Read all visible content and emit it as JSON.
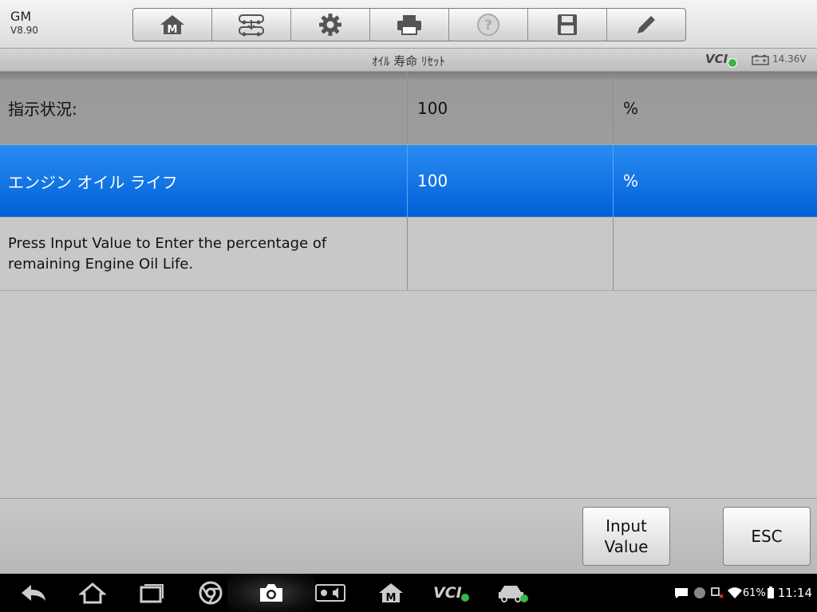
{
  "header": {
    "brand": "GM",
    "version": "V8.90",
    "toolbar": [
      {
        "icon": "home-icon"
      },
      {
        "icon": "vehicle-swap-icon"
      },
      {
        "icon": "gear-icon"
      },
      {
        "icon": "printer-icon"
      },
      {
        "icon": "help-icon"
      },
      {
        "icon": "save-icon"
      },
      {
        "icon": "pencil-icon"
      }
    ]
  },
  "titlebar": {
    "title": "ｵｲﾙ 寿命 ﾘｾｯﾄ",
    "vci": "VCI",
    "voltage": "14.36V"
  },
  "table": {
    "rows": [
      {
        "label": "指示状況:",
        "value": "100",
        "unit": "%"
      },
      {
        "label": "エンジン オイル ライフ",
        "value": "100",
        "unit": "%"
      },
      {
        "label": "Press Input Value to Enter the percentage of remaining Engine Oil Life.",
        "value": "",
        "unit": ""
      }
    ]
  },
  "actions": {
    "input_value": "Input Value",
    "esc": "ESC"
  },
  "status": {
    "battery": "61%",
    "time": "11:14"
  },
  "colors": {
    "selected_row": "#1f7ff0",
    "vci_connected": "#3bb54a"
  }
}
